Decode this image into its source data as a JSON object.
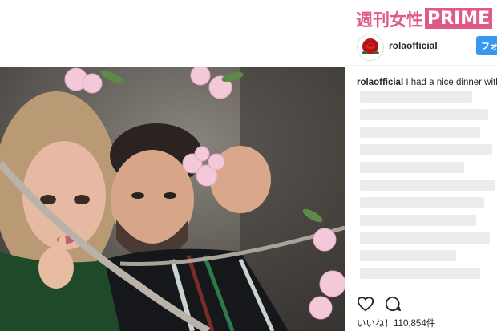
{
  "brand": {
    "jp": "週刊女性",
    "en": "PRIME"
  },
  "post": {
    "username": "rolaofficial",
    "follow_label": "フォロ",
    "caption_user": "rolaofficial",
    "caption_text": "I had a nice dinner with",
    "likes_label": "いいね！110,854件"
  },
  "icons": [
    "heart-icon",
    "comment-icon",
    "rose-avatar-icon"
  ],
  "colors": {
    "brand_pink": "#e05a86",
    "follow_blue": "#3897f0"
  }
}
